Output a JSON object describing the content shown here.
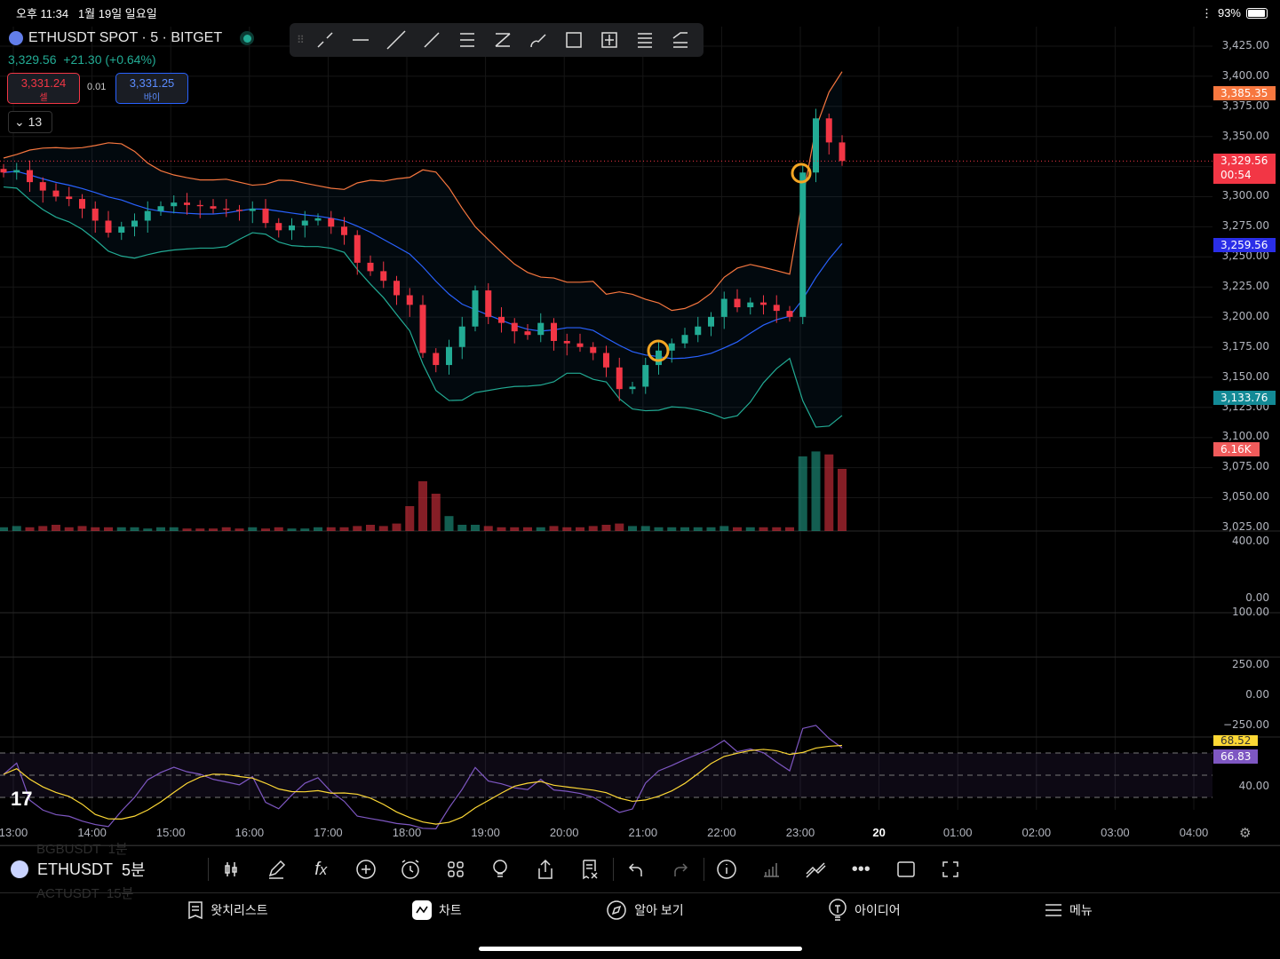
{
  "status": {
    "time": "오후 11:34",
    "date": "1월 19일 일요일",
    "battery": "93%",
    "battery_level": 0.93
  },
  "symbol": {
    "title": "ETHUSDT SPOT · 5 · BITGET",
    "last": "3,329.56",
    "change": "+21.30 (+0.64%)"
  },
  "trade": {
    "sell_price": "3,331.24",
    "sell_label": "셀",
    "spread": "0.01",
    "buy_price": "3,331.25",
    "buy_label": "바이"
  },
  "indicators_collapsed": "13",
  "drawing_tools": [
    "trend-line",
    "horizontal-ray",
    "extended-line",
    "ray",
    "parallel-channel",
    "regression-trend",
    "brush",
    "rectangle",
    "price-range",
    "fib-retracement",
    "pitchfork"
  ],
  "colors": {
    "up": "#22ab94",
    "down": "#f23645",
    "bb_upper": "#f7525f",
    "bb_basis": "#2962ff",
    "bb_lower": "#22ab94",
    "rsi": "#7e57c2",
    "rsi_ma": "#fdd835"
  },
  "price_axis": [
    "3,425.00",
    "3,400.00",
    "3,375.00",
    "3,350.00",
    "3,300.00",
    "3,275.00",
    "3,250.00",
    "3,225.00",
    "3,200.00",
    "3,175.00",
    "3,150.00",
    "3,125.00",
    "3,100.00",
    "3,075.00",
    "3,050.00",
    "3,025.00"
  ],
  "tags": {
    "bb_upper": "3,385.35",
    "last": "3,329.56",
    "countdown": "00:54",
    "bb_basis": "3,259.56",
    "bb_lower": "3,133.76",
    "volume": "6.16K",
    "rsi_ma": "68.52",
    "rsi": "66.83"
  },
  "pane2_axis": [
    "400.00",
    "0.00"
  ],
  "pane3_axis": [
    "100.00",
    "250.00",
    "0.00",
    "−250.00"
  ],
  "rsi_axis": [
    "40.00"
  ],
  "time_axis": [
    "13:00",
    "14:00",
    "15:00",
    "16:00",
    "17:00",
    "18:00",
    "19:00",
    "20:00",
    "21:00",
    "22:00",
    "23:00",
    "20",
    "01:00",
    "02:00",
    "03:00",
    "04:00"
  ],
  "chart_data": {
    "type": "candlestick",
    "interval": "10min anchors",
    "x_start": "13:00",
    "close": [
      3320,
      3322,
      3312,
      3305,
      3300,
      3298,
      3290,
      3280,
      3270,
      3275,
      3280,
      3288,
      3292,
      3295,
      3293,
      3292,
      3290,
      3289,
      3288,
      3290,
      3278,
      3272,
      3276,
      3280,
      3282,
      3275,
      3268,
      3245,
      3238,
      3230,
      3218,
      3210,
      3170,
      3160,
      3175,
      3192,
      3222,
      3200,
      3195,
      3188,
      3185,
      3195,
      3180,
      3178,
      3175,
      3170,
      3158,
      3140,
      3142,
      3160,
      3172,
      3178,
      3185,
      3192,
      3200,
      3215,
      3208,
      3212,
      3210,
      3205,
      3200,
      3320,
      3365,
      3345,
      3329.56
    ],
    "volume_k": [
      0.3,
      0.4,
      0.3,
      0.4,
      0.5,
      0.3,
      0.4,
      0.3,
      0.3,
      0.3,
      0.3,
      0.2,
      0.3,
      0.3,
      0.2,
      0.2,
      0.2,
      0.3,
      0.2,
      0.3,
      0.2,
      0.3,
      0.2,
      0.2,
      0.3,
      0.3,
      0.3,
      0.4,
      0.5,
      0.4,
      0.6,
      2.0,
      4.0,
      3.0,
      1.2,
      0.5,
      0.5,
      0.4,
      0.3,
      0.3,
      0.3,
      0.3,
      0.4,
      0.3,
      0.3,
      0.4,
      0.5,
      0.6,
      0.4,
      0.4,
      0.3,
      0.3,
      0.3,
      0.3,
      0.3,
      0.4,
      0.3,
      0.3,
      0.3,
      0.3,
      0.3,
      6.0,
      6.4,
      6.16,
      5.0
    ],
    "ylim": [
      3025,
      3425
    ]
  },
  "toolbar": {
    "symbol": "ETHUSDT",
    "interval": "5분",
    "ghost_above": "BGBUSDT  1분",
    "ghost_below": "ACTUSDT  15분"
  },
  "nav": [
    {
      "label": "왓치리스트",
      "icon": "bookmark-list"
    },
    {
      "label": "차트",
      "icon": "chart"
    },
    {
      "label": "알아 보기",
      "icon": "compass"
    },
    {
      "label": "아이디어",
      "icon": "lightbulb"
    },
    {
      "label": "메뉴",
      "icon": "menu"
    }
  ]
}
